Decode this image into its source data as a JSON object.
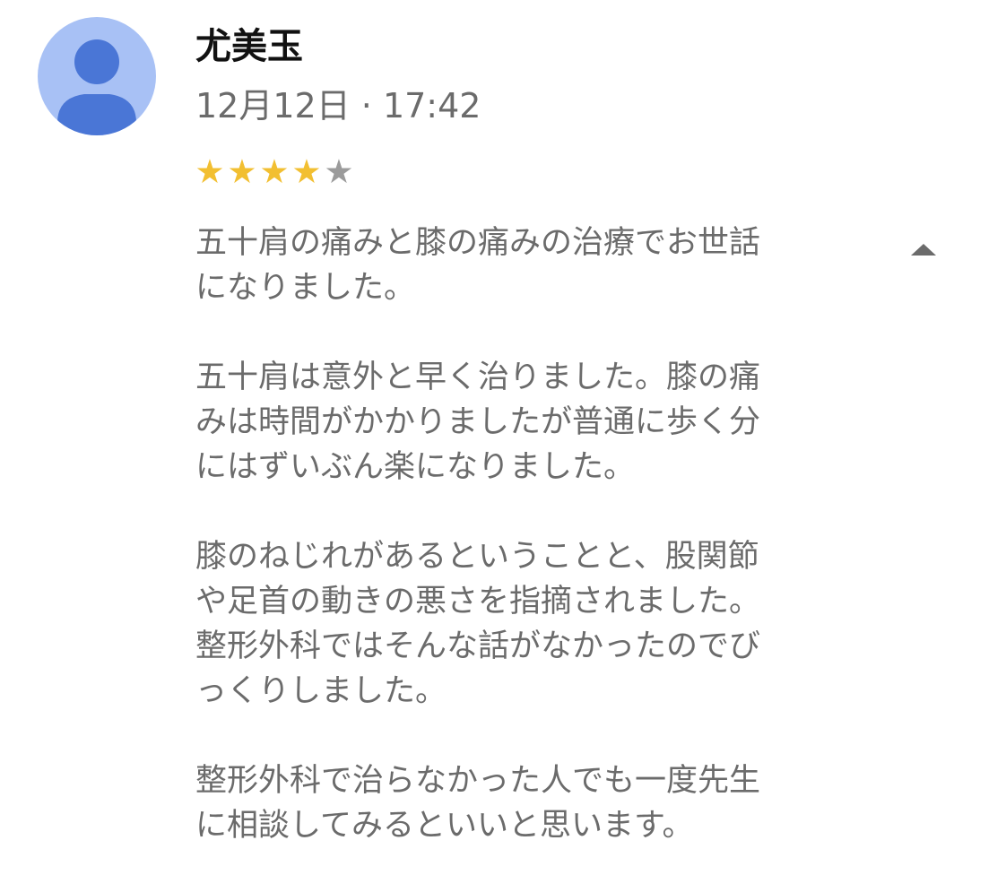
{
  "review": {
    "author": "尤美玉",
    "timestamp": "12月12日 · 17:42",
    "rating": {
      "value": 4,
      "max": 5,
      "filled_color": "#f2bf31",
      "empty_color": "#9b9b9b"
    },
    "avatar_icon": "person-icon",
    "collapse_icon": "caret-up-icon",
    "paragraphs": [
      [
        "五十肩の痛みと膝の痛みの治療でお世話",
        "になりました。"
      ],
      [
        "五十肩は意外と早く治りました。膝の痛",
        "みは時間がかかりましたが普通に歩く分",
        "にはずいぶん楽になりました。"
      ],
      [
        "膝のねじれがあるということと、股関節",
        "や足首の動きの悪さを指摘されました。",
        "整形外科ではそんな話がなかったのでび",
        "っくりしました。"
      ],
      [
        "整形外科で治らなかった人でも一度先生",
        "に相談してみるといいと思います。"
      ]
    ]
  }
}
